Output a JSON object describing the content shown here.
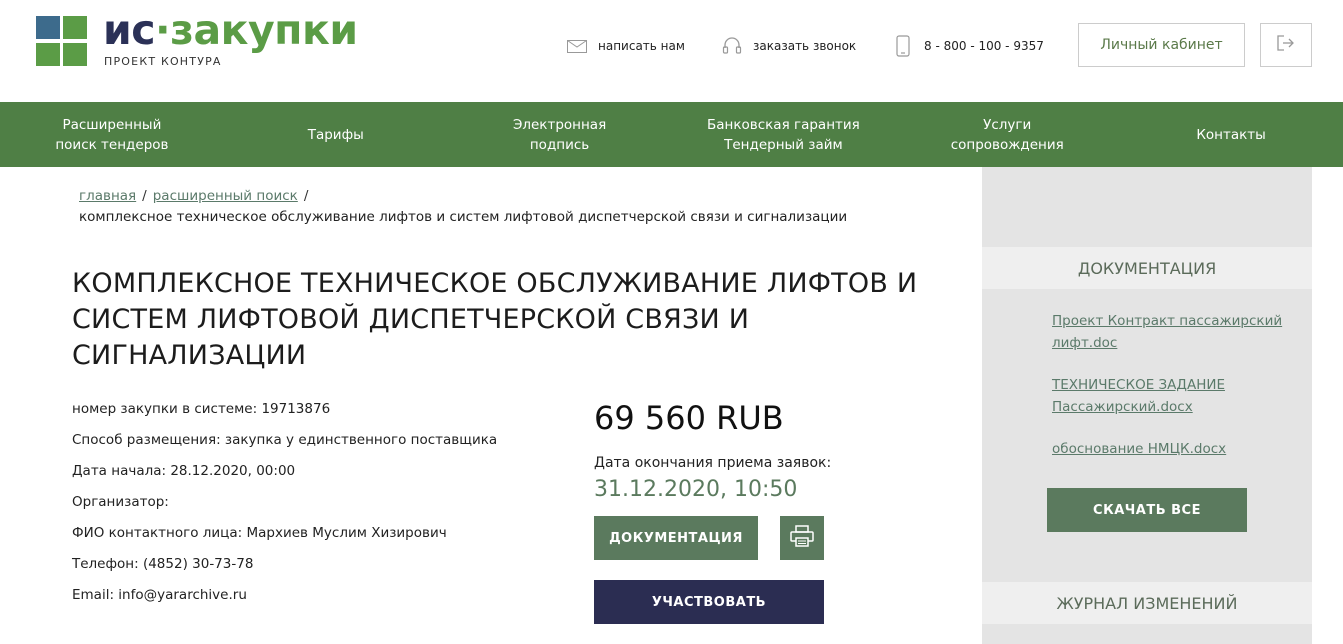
{
  "logo": {
    "part1": "ис",
    "dot": "·",
    "part2": "закупки",
    "subtitle": "ПРОЕКТ КОНТУРА"
  },
  "header": {
    "write_us": "написать нам",
    "call_back": "заказать звонок",
    "phone": "8 - 800 - 100 - 9357",
    "cabinet": "Личный кабинет"
  },
  "nav": {
    "items": [
      {
        "label": "Расширенный\nпоиск тендеров"
      },
      {
        "label": "Тарифы"
      },
      {
        "label": "Электронная\nподпись"
      },
      {
        "label": "Банковская гарантия\nТендерный займ"
      },
      {
        "label": "Услуги\nсопровождения"
      },
      {
        "label": "Контакты"
      }
    ]
  },
  "breadcrumb": {
    "home": "главная",
    "search": "расширенный поиск",
    "separator": "/",
    "current": "комплексное техническое обслуживание лифтов и систем лифтовой диспетчерской связи и сигнализации"
  },
  "title": "КОМПЛЕКСНОЕ ТЕХНИЧЕСКОЕ ОБСЛУЖИВАНИЕ ЛИФТОВ И СИСТЕМ ЛИФТОВОЙ ДИСПЕТЧЕРСКОЙ СВЯЗИ И СИГНАЛИЗАЦИИ",
  "info": {
    "number": "номер закупки в системе: 19713876",
    "method": "Способ размещения: закупка у единственного поставщика",
    "start": "Дата начала: 28.12.2020, 00:00",
    "organizer": "Организатор:",
    "contact": "ФИО контактного лица: Мархиев Муслим Хизирович",
    "phone": "Телефон: (4852) 30-73-78",
    "email": "Email: info@yararchive.ru"
  },
  "price": "69 560 RUB",
  "deadline": {
    "label": "Дата окончания приема заявок:",
    "value": "31.12.2020, 10:50"
  },
  "buttons": {
    "documentation": "ДОКУМЕНТАЦИЯ",
    "participate": "УЧАСТВОВАТЬ"
  },
  "sidebar": {
    "doc_heading": "ДОКУМЕНТАЦИЯ",
    "docs": [
      {
        "name": "Проект Контракт пассажирский лифт.doc"
      },
      {
        "name": "ТЕХНИЧЕСКОЕ ЗАДАНИЕ Пассажирский.docx"
      },
      {
        "name": "обоснование НМЦК.docx"
      }
    ],
    "download_all": "СКАЧАТЬ ВСЕ",
    "changes_heading": "ЖУРНАЛ ИЗМЕНЕНИЙ"
  },
  "colors": {
    "brand_green": "#4f7f45",
    "brand_navy": "#2b2d52",
    "accent_green": "#5b7a5e"
  }
}
